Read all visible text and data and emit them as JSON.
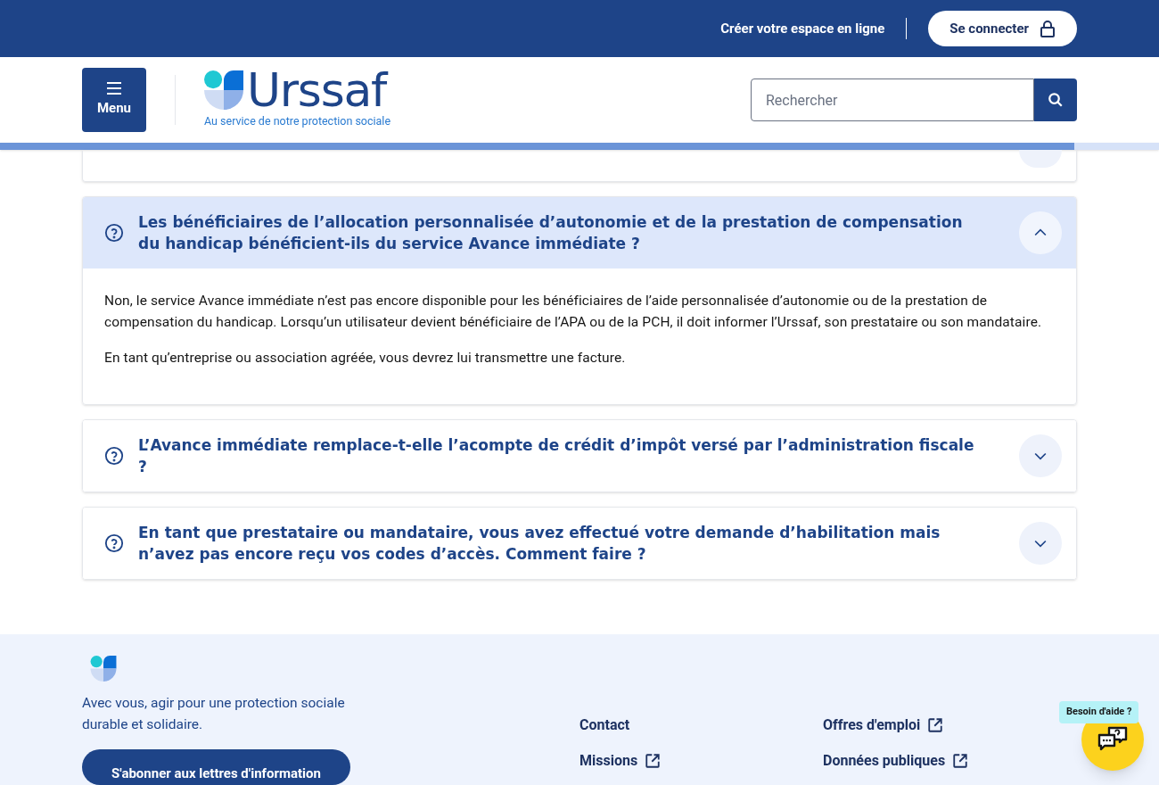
{
  "top_bar": {
    "create_account_link": "Créer votre espace en ligne",
    "login_button": "Se connecter"
  },
  "header": {
    "menu_button": "Menu",
    "logo_text": "Urssaf",
    "tagline": "Au service de notre protection sociale",
    "search": {
      "placeholder": "Rechercher"
    },
    "reading_progress": {
      "level": 0.927
    }
  },
  "faq": [
    {
      "kind": "hidden",
      "expanded": false
    },
    {
      "kind": "question",
      "question": "Les bénéficiaires de l’allocation personnalisée d’autonomie et de la prestation de compensation du handicap bénéficient-ils du service Avance immédiate ?",
      "expanded": true,
      "answer": [
        "Non, le service Avance immédiate n’est pas encore disponible pour les bénéficiaires de l’aide personnalisée d’autonomie ou de la prestation de compensation du handicap. Lorsqu’un utilisateur devient bénéficiaire de l’APA ou de la PCH, il doit informer l’Urssaf, son prestataire ou son mandataire.",
        "En tant qu’entreprise ou association agréée, vous devrez lui transmettre une facture."
      ]
    },
    {
      "kind": "question",
      "question": "L’Avance immédiate remplace-t-elle l’acompte de crédit d’impôt versé par l’administration fiscale ?",
      "expanded": false
    },
    {
      "kind": "question",
      "question": "En tant que prestataire ou mandataire, vous avez effectué votre demande d’habilitation mais n’avez pas encore reçu vos codes d’accès. Comment faire ?",
      "expanded": false
    }
  ],
  "footer": {
    "slogan": "Avec vous, agir pour une protection sociale durable et solidaire.",
    "subscribe_button": "S'abonner aux lettres d'information",
    "links": [
      {
        "label": "Contact",
        "external": false
      },
      {
        "label": "Offres d'emploi",
        "external": true
      },
      {
        "label": "Missions",
        "external": true
      },
      {
        "label": "Données publiques",
        "external": true
      }
    ]
  },
  "help_widget": {
    "label": "Besoin d'aide ?"
  }
}
